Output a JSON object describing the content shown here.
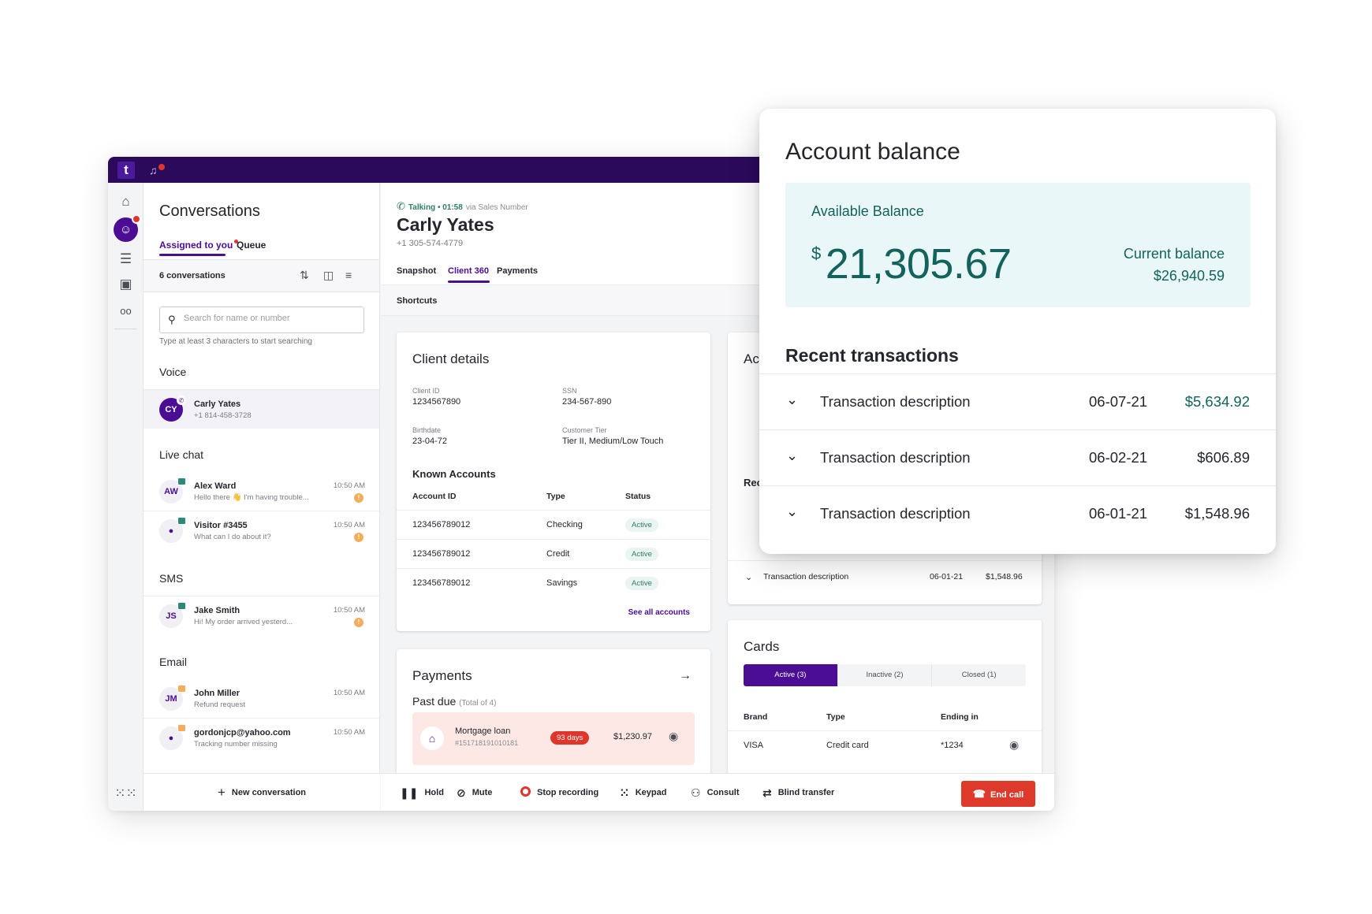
{
  "topbar": {
    "logo": "t",
    "bell_icon": "bell-icon"
  },
  "rail": {
    "items": [
      "home-icon",
      "conversations-icon",
      "activity-list-icon",
      "contacts-icon",
      "voicemail-icon"
    ],
    "apps_icon": "apps-grid-icon"
  },
  "conversations": {
    "title": "Conversations",
    "tabs": [
      {
        "label": "Assigned to you",
        "active": true,
        "has_dot": true
      },
      {
        "label": "Queue",
        "active": false
      }
    ],
    "count_label": "6 conversations",
    "search_placeholder": "Search for name or number",
    "search_hint": "Type at least 3 characters to start searching",
    "sections": {
      "voice": "Voice",
      "live_chat": "Live chat",
      "sms": "SMS",
      "email": "Email"
    },
    "items": [
      {
        "initials": "CY",
        "name": "Carly Yates",
        "sub": "+1 814-458-3728",
        "time": "",
        "channel": "voice",
        "selected": true
      },
      {
        "initials": "AW",
        "name": "Alex Ward",
        "sub": "Hello there 👋 I'm having trouble...",
        "time": "10:50 AM",
        "channel": "chat",
        "alert": "!"
      },
      {
        "initials": "",
        "name": "Visitor #3455",
        "sub": "What can I do about it?",
        "time": "10:50 AM",
        "channel": "chat",
        "alert": "!"
      },
      {
        "initials": "JS",
        "name": "Jake Smith",
        "sub": "Hi! My order arrived yesterd...",
        "time": "10:50 AM",
        "channel": "sms",
        "alert": "!"
      },
      {
        "initials": "JM",
        "name": "John Miller",
        "sub": "Refund request",
        "time": "10:50 AM",
        "channel": "email"
      },
      {
        "initials": "",
        "name": "gordonjcp@yahoo.com",
        "sub": "Tracking number missing",
        "time": "10:50 AM",
        "channel": "email"
      }
    ],
    "new_conversation": "New conversation"
  },
  "call": {
    "status": "Talking • 01:58",
    "via": "via Sales Number",
    "client_name": "Carly Yates",
    "client_phone": "+1 305-574-4779",
    "tabs": [
      "Snapshot",
      "Client 360",
      "Payments"
    ],
    "active_tab": "Client 360",
    "shortcuts": "Shortcuts"
  },
  "client_details": {
    "title": "Client details",
    "fields": [
      {
        "label": "Client ID",
        "value": "1234567890"
      },
      {
        "label": "SSN",
        "value": "234-567-890"
      },
      {
        "label": "Birthdate",
        "value": "23-04-72"
      },
      {
        "label": "Customer Tier",
        "value": "Tier II, Medium/Low Touch"
      }
    ],
    "known_accounts": {
      "title": "Known Accounts",
      "columns": [
        "Account ID",
        "Type",
        "Status"
      ],
      "rows": [
        [
          "123456789012",
          "Checking",
          "Active"
        ],
        [
          "123456789012",
          "Credit",
          "Active"
        ],
        [
          "123456789012",
          "Savings",
          "Active"
        ]
      ],
      "see_all": "See all accounts"
    }
  },
  "payments": {
    "title": "Payments",
    "past_due_label": "Past due",
    "past_due_total": "(Total of 4)",
    "items": [
      {
        "name": "Mortgage loan",
        "number": "#151718191010181",
        "days": "93 days",
        "amount": "$1,230.97"
      }
    ]
  },
  "account_behind": {
    "title_fragment": "Ac",
    "recent_fragment": "Rec",
    "last_row": {
      "desc": "Transaction description",
      "date": "06-01-21",
      "amount": "$1,548.96"
    }
  },
  "cards": {
    "title": "Cards",
    "filters": [
      {
        "label": "Active (3)",
        "active": true
      },
      {
        "label": "Inactive (2)"
      },
      {
        "label": "Closed (1)"
      }
    ],
    "columns": [
      "Brand",
      "Type",
      "Ending in"
    ],
    "rows": [
      [
        "VISA",
        "Credit card",
        "*1234"
      ]
    ]
  },
  "call_controls": {
    "hold": "Hold",
    "mute": "Mute",
    "stop_recording": "Stop recording",
    "keypad": "Keypad",
    "consult": "Consult",
    "blind_transfer": "Blind transfer",
    "end_call": "End call"
  },
  "account_balance": {
    "title": "Account balance",
    "available_label": "Available Balance",
    "currency_symbol": "$",
    "available_amount": "21,305.67",
    "current_label": "Current balance",
    "current_amount": "$26,940.59",
    "recent_title": "Recent transactions",
    "transactions": [
      {
        "desc": "Transaction description",
        "date": "06-07-21",
        "amount": "$5,634.92",
        "positive": true
      },
      {
        "desc": "Transaction description",
        "date": "06-02-21",
        "amount": "$606.89",
        "positive": false
      },
      {
        "desc": "Transaction description",
        "date": "06-01-21",
        "amount": "$1,548.96",
        "positive": false
      }
    ]
  },
  "colors": {
    "brand_purple": "#4a0d94",
    "topbar": "#2b0a5c",
    "teal": "#13635c",
    "danger": "#dd3a2b",
    "balance_bg": "#e9f7f8"
  }
}
